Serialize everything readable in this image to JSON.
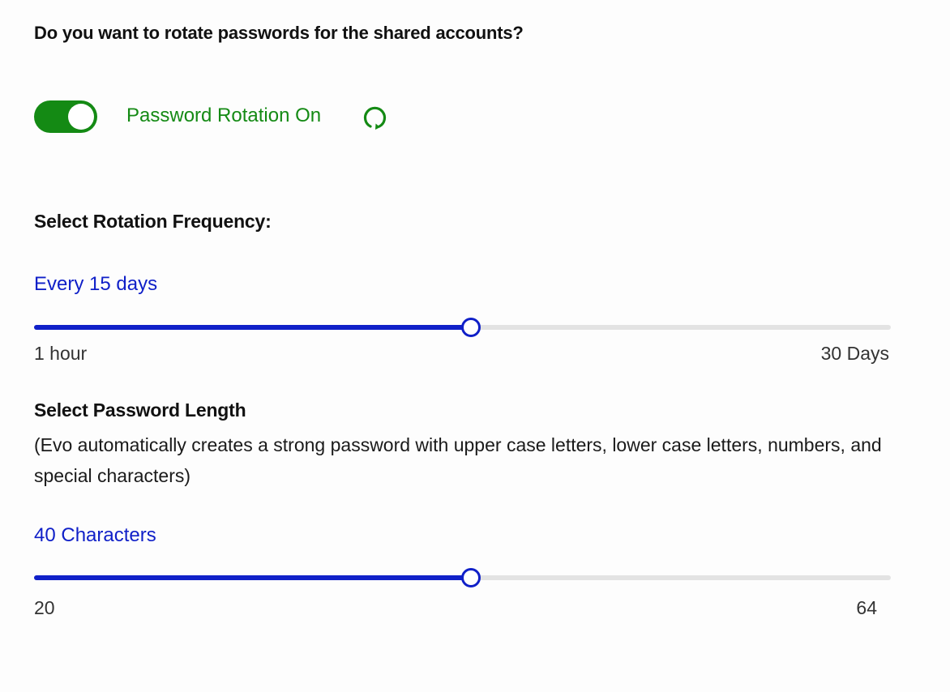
{
  "question": "Do you want to rotate passwords for the shared accounts?",
  "toggle": {
    "state": "on",
    "label": "Password Rotation On",
    "color": "#148a14",
    "icon": "refresh-icon"
  },
  "frequency": {
    "title": "Select Rotation Frequency:",
    "value_label": "Every 15 days",
    "min_label": "1 hour",
    "max_label": "30 Days",
    "fraction": 0.51
  },
  "length": {
    "title": "Select Password Length",
    "description": "(Evo automatically creates a strong password with upper case letters, lower case letters, numbers, and special characters)",
    "value_label": "40 Characters",
    "min_label": "20",
    "max_label": "64",
    "fraction": 0.51
  },
  "colors": {
    "accent": "#1020c8",
    "track": "#e3e3e3",
    "toggle_on": "#148a14"
  }
}
